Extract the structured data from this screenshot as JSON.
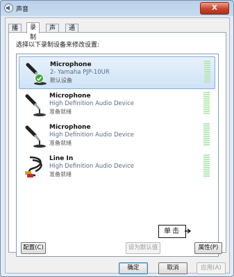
{
  "window": {
    "title": "声音",
    "close_label": "X"
  },
  "tabs": [
    {
      "label": "播放",
      "active": false
    },
    {
      "label": "录制",
      "active": true
    },
    {
      "label": "声音",
      "active": false
    },
    {
      "label": "通信",
      "active": false
    }
  ],
  "instruction": "选择以下录制设备来修改设置:",
  "devices": [
    {
      "name": "Microphone",
      "description": "2- Yamaha PJP-10UR",
      "status": "默认设备",
      "icon": "microphone-icon",
      "selected": true,
      "default_check": true
    },
    {
      "name": "Microphone",
      "description": "High Definition Audio Device",
      "status": "准备就绪",
      "icon": "microphone-icon",
      "selected": false
    },
    {
      "name": "Microphone",
      "description": "High Definition Audio Device",
      "status": "准备就绪",
      "icon": "microphone-icon",
      "selected": false
    },
    {
      "name": "Line In",
      "description": "High Definition Audio Device",
      "status": "准备就绪",
      "icon": "rca-cable-icon",
      "selected": false
    }
  ],
  "buttons": {
    "configure": "配置(C)",
    "set_default": "设为默认值",
    "properties": "属性(P)",
    "ok": "确定",
    "cancel": "取消",
    "apply": "应用(A)"
  },
  "annotation": {
    "text": "单击"
  },
  "colors": {
    "selection": "#cfe3f7",
    "meter": "#b8e7b8",
    "close": "#c8432b"
  }
}
